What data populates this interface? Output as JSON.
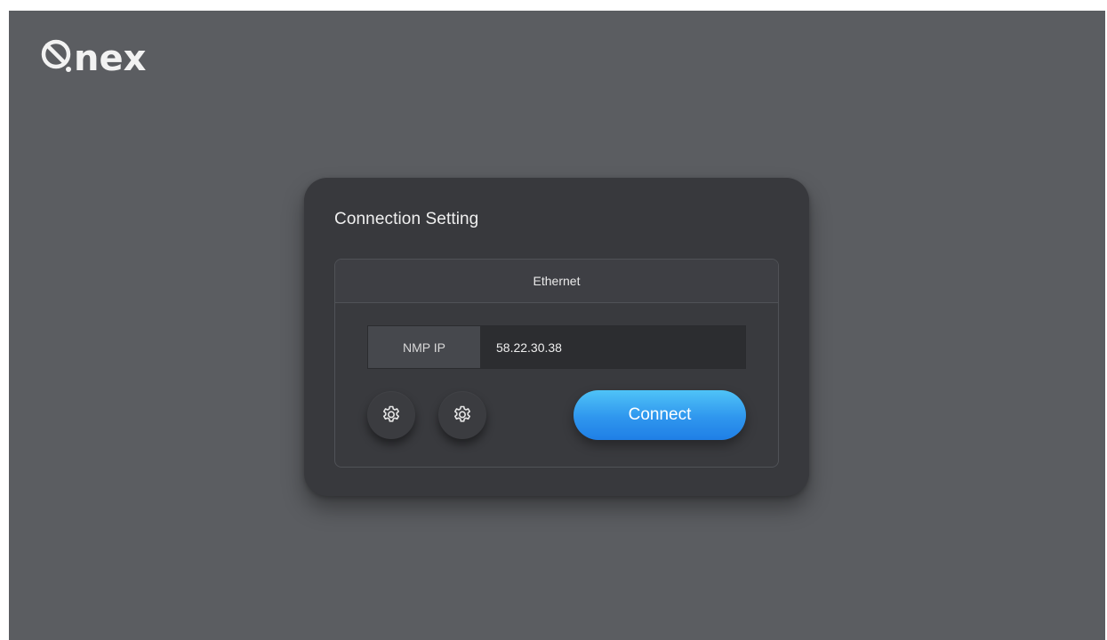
{
  "brand": {
    "logo_text": "nex"
  },
  "dialog": {
    "title": "Connection Setting",
    "tab_label": "Ethernet",
    "nmp_ip": {
      "label": "NMP IP",
      "value": "58.22.30.38"
    },
    "buttons": {
      "settings_1_icon": "gear-icon",
      "settings_2_icon": "gear-icon",
      "connect_label": "Connect"
    }
  },
  "colors": {
    "background": "#5b5d61",
    "dialog": "#38393d",
    "accent": "#2f96ee"
  }
}
